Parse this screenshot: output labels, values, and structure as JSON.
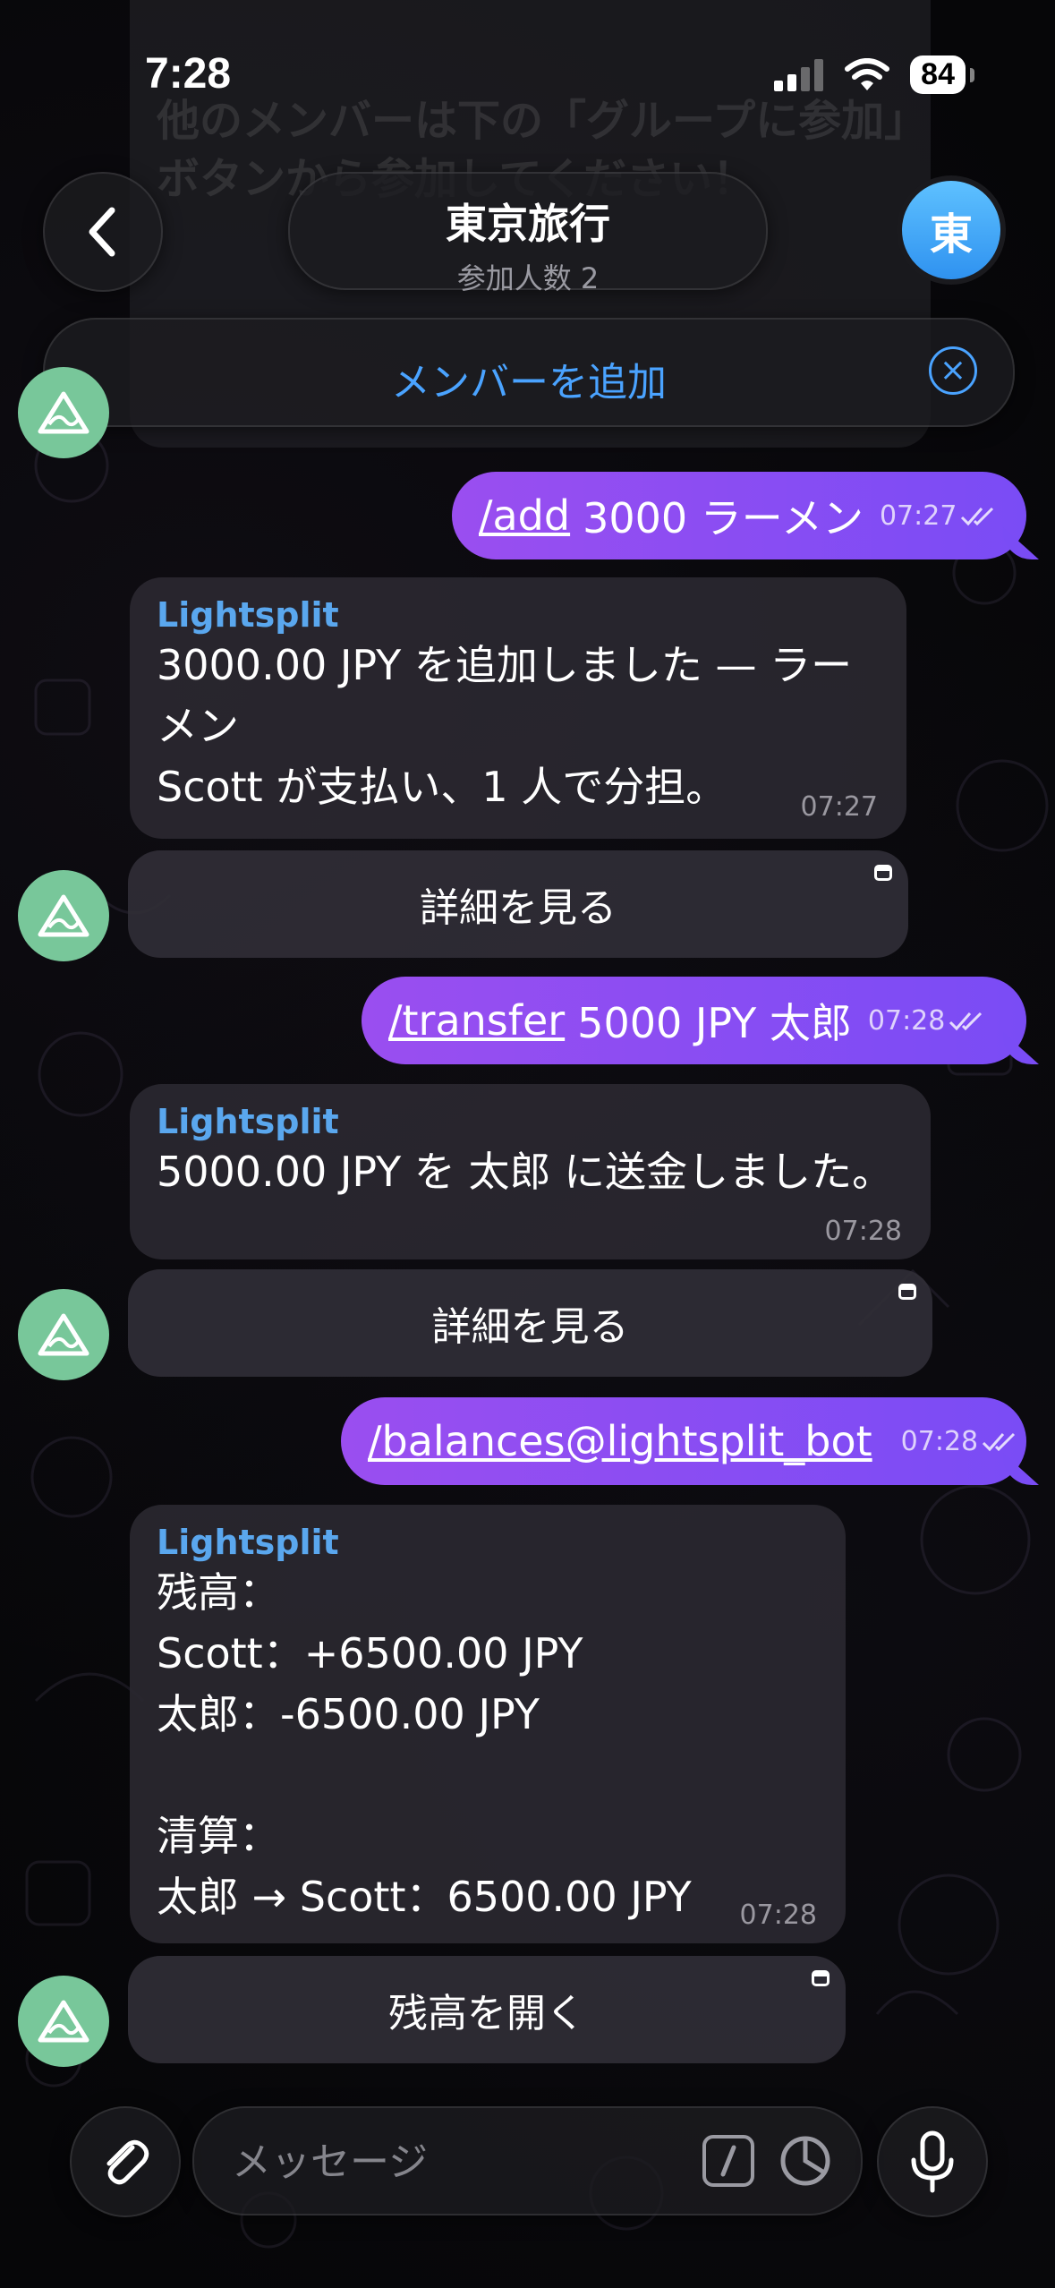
{
  "status_bar": {
    "time": "7:28",
    "battery": "84"
  },
  "header": {
    "title": "東京旅行",
    "subtitle": "参加人数 2",
    "avatar_letter": "東"
  },
  "background_message": {
    "line1": "他のメンバーは下の「グループに参加」",
    "line2": "ボタンから参加してください！"
  },
  "add_member": {
    "label": "メンバーを追加"
  },
  "messages": [
    {
      "command": "/add",
      "text": "3000 ラーメン",
      "time": "07:27"
    },
    {
      "sender": "Lightsplit",
      "lines": [
        "3000.00 JPY を追加しました — ラー",
        "メン",
        "Scott が支払い、1 人で分担。"
      ],
      "time": "07:27",
      "button": "詳細を見る"
    },
    {
      "command": "/transfer",
      "text": "5000 JPY 太郎",
      "time": "07:28"
    },
    {
      "sender": "Lightsplit",
      "lines": [
        "5000.00 JPY を 太郎 に送金しました。"
      ],
      "time": "07:28",
      "button": "詳細を見る"
    },
    {
      "command": "/balances@lightsplit_bot",
      "text": "",
      "time": "07:28"
    },
    {
      "sender": "Lightsplit",
      "lines": [
        "残高：",
        "Scott：+6500.00 JPY",
        "太郎：-6500.00 JPY",
        "",
        "清算：",
        "太郎 → Scott：6500.00 JPY"
      ],
      "time": "07:28",
      "button": "残高を開く"
    }
  ],
  "input": {
    "placeholder": "メッセージ"
  },
  "colors": {
    "accent_blue": "#4aa3ff",
    "outgoing_bubble": "#8a4df2",
    "bot_avatar": "#78c79a"
  }
}
